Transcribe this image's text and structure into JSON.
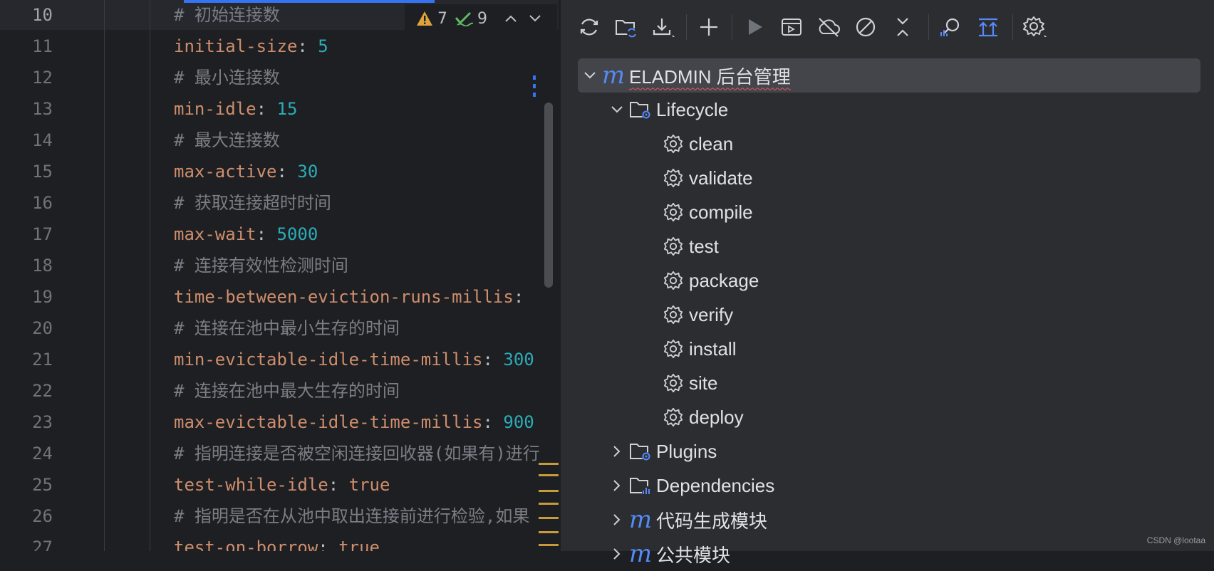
{
  "editor": {
    "active_line": "10",
    "lines": [
      {
        "n": "10",
        "parts": [
          {
            "t": "# 初始连接数",
            "c": "cmt"
          }
        ]
      },
      {
        "n": "11",
        "parts": [
          {
            "t": "initial-size",
            "c": "key"
          },
          {
            "t": ": ",
            "c": "punc"
          },
          {
            "t": "5",
            "c": "num"
          }
        ]
      },
      {
        "n": "12",
        "parts": [
          {
            "t": "# 最小连接数",
            "c": "cmt"
          }
        ]
      },
      {
        "n": "13",
        "parts": [
          {
            "t": "min-idle",
            "c": "key"
          },
          {
            "t": ": ",
            "c": "punc"
          },
          {
            "t": "15",
            "c": "num"
          }
        ]
      },
      {
        "n": "14",
        "parts": [
          {
            "t": "# 最大连接数",
            "c": "cmt"
          }
        ]
      },
      {
        "n": "15",
        "parts": [
          {
            "t": "max-active",
            "c": "key"
          },
          {
            "t": ": ",
            "c": "punc"
          },
          {
            "t": "30",
            "c": "num"
          }
        ]
      },
      {
        "n": "16",
        "parts": [
          {
            "t": "# 获取连接超时时间",
            "c": "cmt"
          }
        ]
      },
      {
        "n": "17",
        "parts": [
          {
            "t": "max-wait",
            "c": "key"
          },
          {
            "t": ": ",
            "c": "punc"
          },
          {
            "t": "5000",
            "c": "num"
          }
        ]
      },
      {
        "n": "18",
        "parts": [
          {
            "t": "# 连接有效性检测时间",
            "c": "cmt"
          }
        ]
      },
      {
        "n": "19",
        "parts": [
          {
            "t": "time-between-eviction-runs-millis",
            "c": "key"
          },
          {
            "t": ":",
            "c": "punc"
          }
        ]
      },
      {
        "n": "20",
        "parts": [
          {
            "t": "# 连接在池中最小生存的时间",
            "c": "cmt"
          }
        ]
      },
      {
        "n": "21",
        "parts": [
          {
            "t": "min-evictable-idle-time-millis",
            "c": "key"
          },
          {
            "t": ": ",
            "c": "punc"
          },
          {
            "t": "300",
            "c": "num"
          }
        ]
      },
      {
        "n": "22",
        "parts": [
          {
            "t": "# 连接在池中最大生存的时间",
            "c": "cmt"
          }
        ]
      },
      {
        "n": "23",
        "parts": [
          {
            "t": "max-evictable-idle-time-millis",
            "c": "key"
          },
          {
            "t": ": ",
            "c": "punc"
          },
          {
            "t": "900",
            "c": "num"
          }
        ]
      },
      {
        "n": "24",
        "parts": [
          {
            "t": "# 指明连接是否被空闲连接回收器(如果有)进行",
            "c": "cmt"
          }
        ]
      },
      {
        "n": "25",
        "parts": [
          {
            "t": "test-while-idle",
            "c": "key"
          },
          {
            "t": ": ",
            "c": "punc"
          },
          {
            "t": "true",
            "c": "bool"
          }
        ]
      },
      {
        "n": "26",
        "parts": [
          {
            "t": "# 指明是否在从池中取出连接前进行检验,如果",
            "c": "cmt"
          }
        ]
      },
      {
        "n": "27",
        "parts": [
          {
            "t": "test-on-borrow",
            "c": "key"
          },
          {
            "t": ": ",
            "c": "punc"
          },
          {
            "t": "true",
            "c": "bool"
          }
        ]
      }
    ],
    "inspection": {
      "warnings": "7",
      "passed": "9"
    }
  },
  "maven": {
    "toolbar_icons": [
      "reload-icon",
      "folder-sync-icon",
      "download-icon",
      "add-icon",
      "run-icon",
      "execute-goal-icon",
      "offline-icon",
      "skip-tests-icon",
      "collapse-icon",
      "analyze-dependencies-icon",
      "show-dependencies-icon",
      "settings-icon"
    ],
    "tree": {
      "root": "ELADMIN 后台管理",
      "lifecycle_label": "Lifecycle",
      "lifecycle": [
        "clean",
        "validate",
        "compile",
        "test",
        "package",
        "verify",
        "install",
        "site",
        "deploy"
      ],
      "plugins": "Plugins",
      "dependencies": "Dependencies",
      "module_codegen": "代码生成模块",
      "module_common": "公共模块"
    }
  },
  "watermark": "CSDN @lootaa",
  "colors": {
    "accent": "#3574f0",
    "maven_m": "#548af7",
    "warning": "#e0a33b",
    "check": "#5fb865"
  }
}
